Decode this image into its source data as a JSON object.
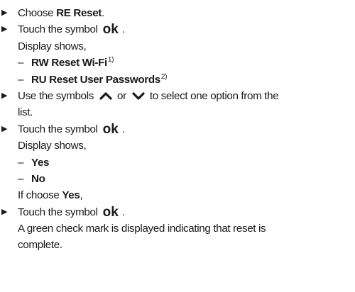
{
  "steps": {
    "s1": {
      "prefix": "Choose ",
      "bold": "RE Reset",
      "suffix": "."
    },
    "s2": {
      "prefix": "Touch the symbol",
      "symbol": "ok",
      "suffix": ".",
      "cont": "Display shows,"
    },
    "s2_options": [
      {
        "dash": "–",
        "bold": "RW Reset Wi-Fi",
        "note": "1)"
      },
      {
        "dash": "–",
        "bold": "RU Reset User Passwords",
        "note": "2)"
      }
    ],
    "s3": {
      "prefix": "Use the symbols",
      "mid": "or",
      "suffix": "to select one option from the",
      "cont": "list."
    },
    "s4": {
      "prefix": "Touch the symbol",
      "symbol": "ok",
      "suffix": ".",
      "cont": "Display shows,"
    },
    "s4_options": [
      {
        "dash": "–",
        "bold": "Yes"
      },
      {
        "dash": "–",
        "bold": "No"
      }
    ],
    "condition": {
      "prefix": "If choose ",
      "bold": "Yes",
      "suffix": ","
    },
    "s5": {
      "prefix": "Touch the symbol",
      "symbol": "ok",
      "suffix": ".",
      "cont1": "A green check mark is displayed indicating that reset is",
      "cont2": "complete."
    }
  },
  "icons": {
    "bullet": "arrow-bullet-icon",
    "up": "chevron-up-icon",
    "down": "chevron-down-icon"
  }
}
